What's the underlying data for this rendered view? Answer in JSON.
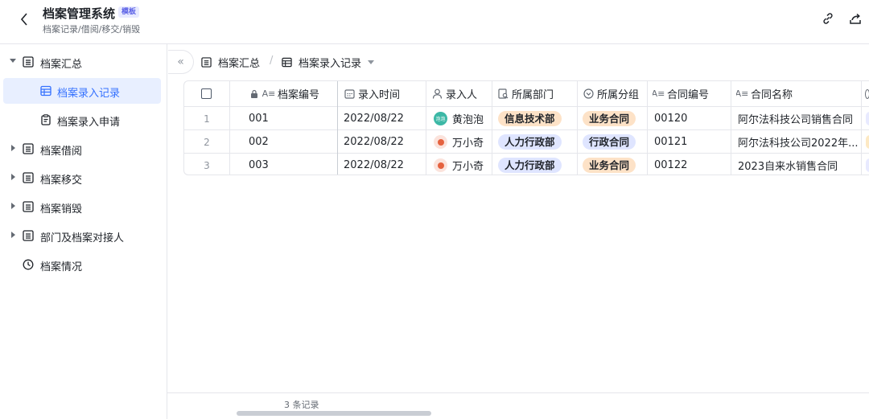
{
  "header": {
    "title": "档案管理系统",
    "badge": "模板",
    "subtitle": "档案记录/借阅/移交/销毁"
  },
  "sidebar": {
    "items": [
      {
        "label": "档案汇总"
      },
      {
        "label": "档案录入记录"
      },
      {
        "label": "档案录入申请"
      },
      {
        "label": "档案借阅"
      },
      {
        "label": "档案移交"
      },
      {
        "label": "档案销毁"
      },
      {
        "label": "部门及档案对接人"
      },
      {
        "label": "档案情况"
      }
    ]
  },
  "toolbar": {
    "crumb_parent": "档案汇总",
    "crumb_current": "档案录入记录",
    "separator": "/"
  },
  "table": {
    "columns": [
      "档案编号",
      "录入时间",
      "录入人",
      "所属部门",
      "所属分组",
      "合同编号",
      "合同名称"
    ],
    "rows": [
      {
        "num": "1",
        "id": "001",
        "time": "2022/08/22",
        "person": "黄泡泡",
        "avatar_text": "泡泡",
        "dept": "信息技术部",
        "group": "业务合同",
        "contract_no": "00120",
        "contract_name": "阿尔法科技公司销售合同"
      },
      {
        "num": "2",
        "id": "002",
        "time": "2022/08/22",
        "person": "万小奇",
        "avatar_text": "",
        "dept": "人力行政部",
        "group": "行政合同",
        "contract_no": "00121",
        "contract_name": "阿尔法科技公司2022年..."
      },
      {
        "num": "3",
        "id": "003",
        "time": "2022/08/22",
        "person": "万小奇",
        "avatar_text": "",
        "dept": "人力行政部",
        "group": "业务合同",
        "contract_no": "00122",
        "contract_name": "2023自来水销售合同"
      }
    ]
  },
  "footer": {
    "record_count": "3 条记录"
  },
  "colors": {
    "accent": "#3370ff",
    "active_bg": "#e8efff",
    "tag_orange": "#fde2c7",
    "tag_blue": "#dfe5ff"
  }
}
